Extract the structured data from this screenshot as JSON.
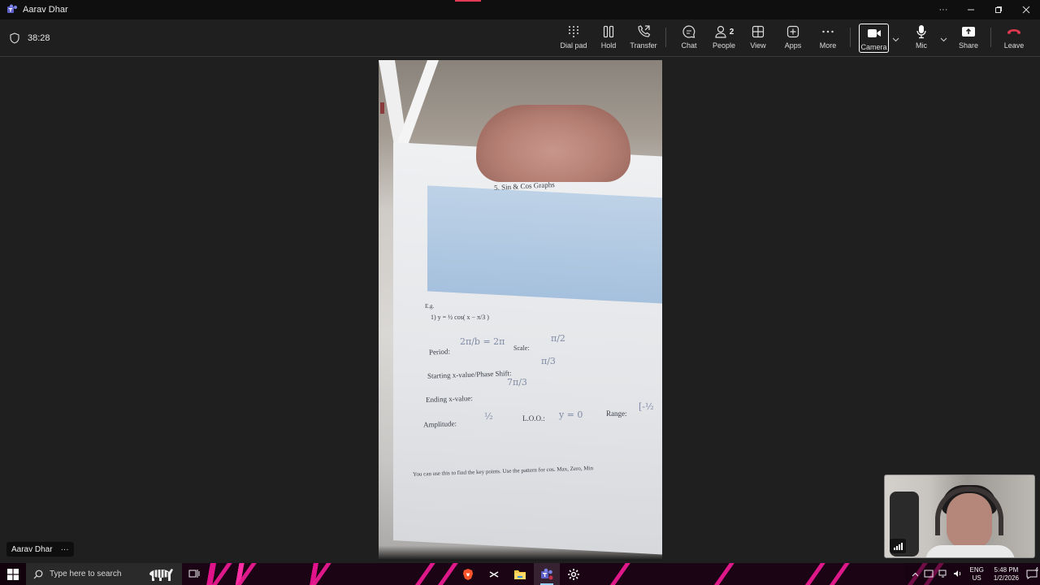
{
  "titlebar": {
    "title": "Aarav Dhar",
    "icon": "teams-icon",
    "controls": [
      "more-options-icon",
      "minimize-icon",
      "restore-icon",
      "close-icon"
    ]
  },
  "meeting": {
    "timer": "38:28",
    "toolbar": {
      "dial_pad": "Dial pad",
      "hold": "Hold",
      "transfer": "Transfer",
      "chat": "Chat",
      "people": "People",
      "people_count": "2",
      "view": "View",
      "apps": "Apps",
      "more": "More",
      "camera": "Camera",
      "mic": "Mic",
      "share": "Share",
      "leave": "Leave"
    },
    "colors": {
      "leave": "#e0384f",
      "accent": "#e03a57"
    }
  },
  "main_video": {
    "worksheet_title": "5. Sin & Cos Graphs",
    "labels": {
      "eg": "E.g.",
      "equation": "1) y = ½ cos( x − π/3 )",
      "period": "Period:",
      "scale": "Scale:",
      "starting": "Starting x-value/Phase Shift:",
      "ending": "Ending x-value:",
      "amplitude": "Amplitude:",
      "loo": "L.O.O.:",
      "range": "Range:",
      "footer": "You can use this to find the key points. Use the pattern for cos. Max, Zero, Min"
    },
    "handwriting": {
      "period": "2π/b = 2π",
      "scale": "π/2",
      "start": "π/3",
      "end": "7π/3",
      "amplitude": "½",
      "loo": "y = 0",
      "range": "[-½"
    }
  },
  "participant": {
    "name": "Aarav Dhar"
  },
  "taskbar": {
    "search_placeholder": "Type here to search",
    "language": "ENG",
    "region": "US",
    "time": "5:48 PM",
    "date": "1/2/2026",
    "notification_count": "4"
  }
}
